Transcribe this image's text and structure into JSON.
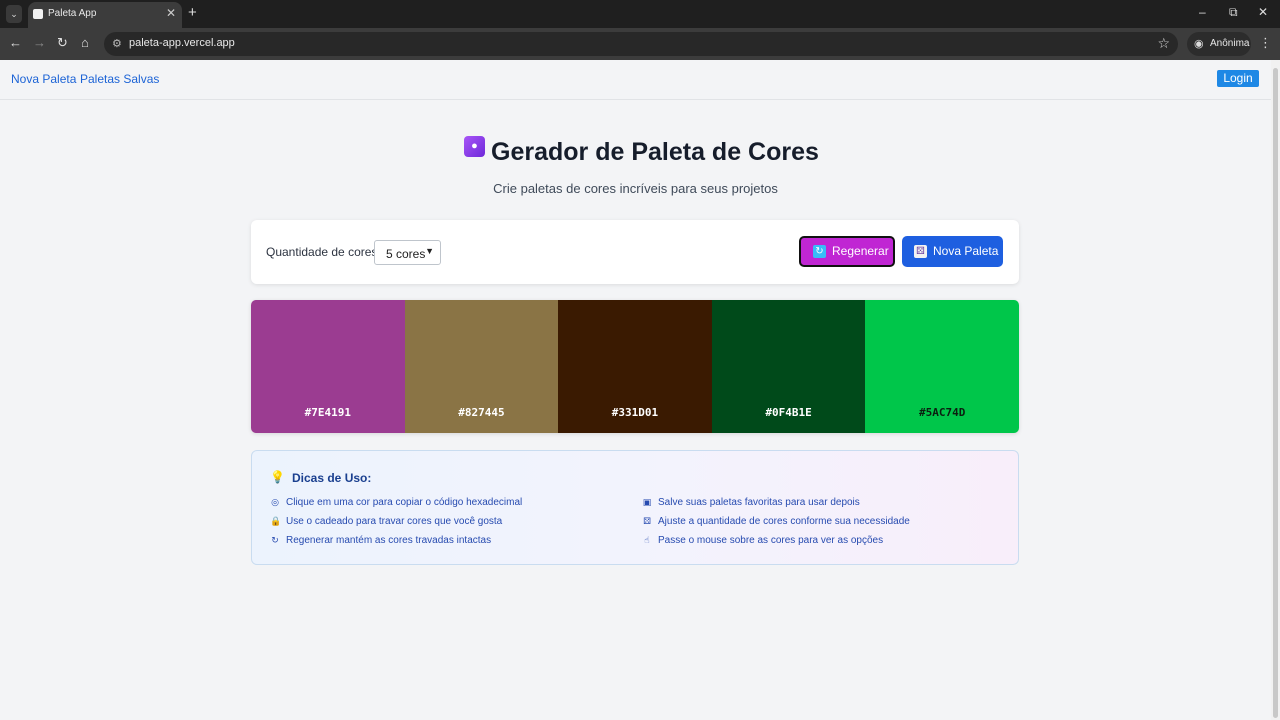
{
  "browser": {
    "tab_title": "Paleta App",
    "url": "paleta-app.vercel.app",
    "profile_label": "Anônima",
    "icons": [
      "tab-list-icon",
      "favicon-icon",
      "close-icon",
      "new-tab-icon",
      "minimize-icon",
      "restore-icon",
      "window-close-icon",
      "back-icon",
      "forward-icon",
      "reload-icon",
      "home-icon",
      "site-info-icon",
      "bookmark-star-icon",
      "incognito-icon",
      "menu-icon"
    ]
  },
  "nav": {
    "links": [
      "Nova Paleta",
      "Paletas Salvas"
    ],
    "login_label": "Login"
  },
  "header": {
    "title": "Gerador de Paleta de Cores",
    "subtitle": "Crie paletas de cores incríveis para seus projetos"
  },
  "controls": {
    "quantity_label": "Quantidade de cores:",
    "quantity_value": "5 cores",
    "regenerate_label": "Regenerar",
    "new_palette_label": "Nova Paleta"
  },
  "palette": {
    "colors": [
      {
        "hex": "#7E4191",
        "swatch": "#9b3c91"
      },
      {
        "hex": "#827445",
        "swatch": "#8a7445"
      },
      {
        "hex": "#331D01",
        "swatch": "#3a1a01"
      },
      {
        "hex": "#0F4B1E",
        "swatch": "#004a1a"
      },
      {
        "hex": "#5AC74D",
        "swatch": "#00c64a"
      }
    ]
  },
  "tips": {
    "title": "Dicas de Uso:",
    "items": [
      "Clique em uma cor para copiar o código hexadecimal",
      "Use o cadeado para travar cores que você gosta",
      "Regenerar mantém as cores travadas intactas",
      "Salve suas paletas favoritas para usar depois",
      "Ajuste a quantidade de cores conforme sua necessidade",
      "Passe o mouse sobre as cores para ver as opções"
    ]
  },
  "colors": {
    "link": "#1d64d6",
    "login": "#1e88e5",
    "regenerate": "#c026d3",
    "new_palette": "#1e5fe0",
    "tips_text": "#274bb0"
  }
}
